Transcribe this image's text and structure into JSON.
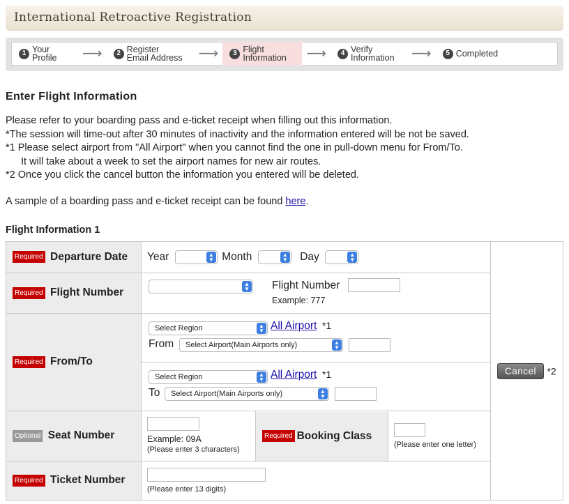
{
  "header": {
    "title": "International Retroactive Registration"
  },
  "steps": [
    {
      "num": "1",
      "label": "Your\nProfile",
      "active": false
    },
    {
      "num": "2",
      "label": "Register\nEmail Address",
      "active": false
    },
    {
      "num": "3",
      "label": "Flight\nInformation",
      "active": true
    },
    {
      "num": "4",
      "label": "Verify\nInformation",
      "active": false
    },
    {
      "num": "5",
      "label": "Completed",
      "active": false
    }
  ],
  "arrow": "⟶",
  "section_title": "Enter Flight Information",
  "notes": {
    "line1": "Please refer to your boarding pass and e-ticket receipt when filling out this information.",
    "line2": "*The session will time-out after 30 minutes of inactivity and the information entered will be not be saved.",
    "line3": "*1 Please select airport from \"All Airport\" when you cannot find the one in pull-down menu for From/To.",
    "line4": "It will take about a week to set the airport names for new air routes.",
    "line5": "*2 Once you click the cancel button the information you entered will be deleted."
  },
  "sample": {
    "text": "A sample of a boarding pass and e-ticket receipt can be found ",
    "link": "here",
    "end": "."
  },
  "flight_info_title": "Flight Information 1",
  "badges": {
    "required": "Required",
    "optional": "Optional"
  },
  "departure": {
    "label": "Departure Date",
    "year": "Year",
    "month": "Month",
    "day": "Day"
  },
  "flight_number": {
    "label": "Flight Number",
    "field_label": "Flight Number",
    "example": "Example: 777"
  },
  "from_to": {
    "label": "From/To",
    "region_placeholder": "Select Region",
    "all_airport": "All Airport",
    "note_ref": "*1",
    "from_label": "From",
    "to_label": "To",
    "airport_placeholder": "Select Airport(Main Airports only)"
  },
  "seat": {
    "label": "Seat Number",
    "example": "Example: 09A",
    "hint": "(Please enter 3 characters)"
  },
  "booking": {
    "label": "Booking Class",
    "hint": "(Please enter one letter)"
  },
  "ticket": {
    "label": "Ticket Number",
    "hint": "(Please enter 13 digits)"
  },
  "cancel": {
    "label": "Cancel",
    "note_ref": "*2"
  }
}
